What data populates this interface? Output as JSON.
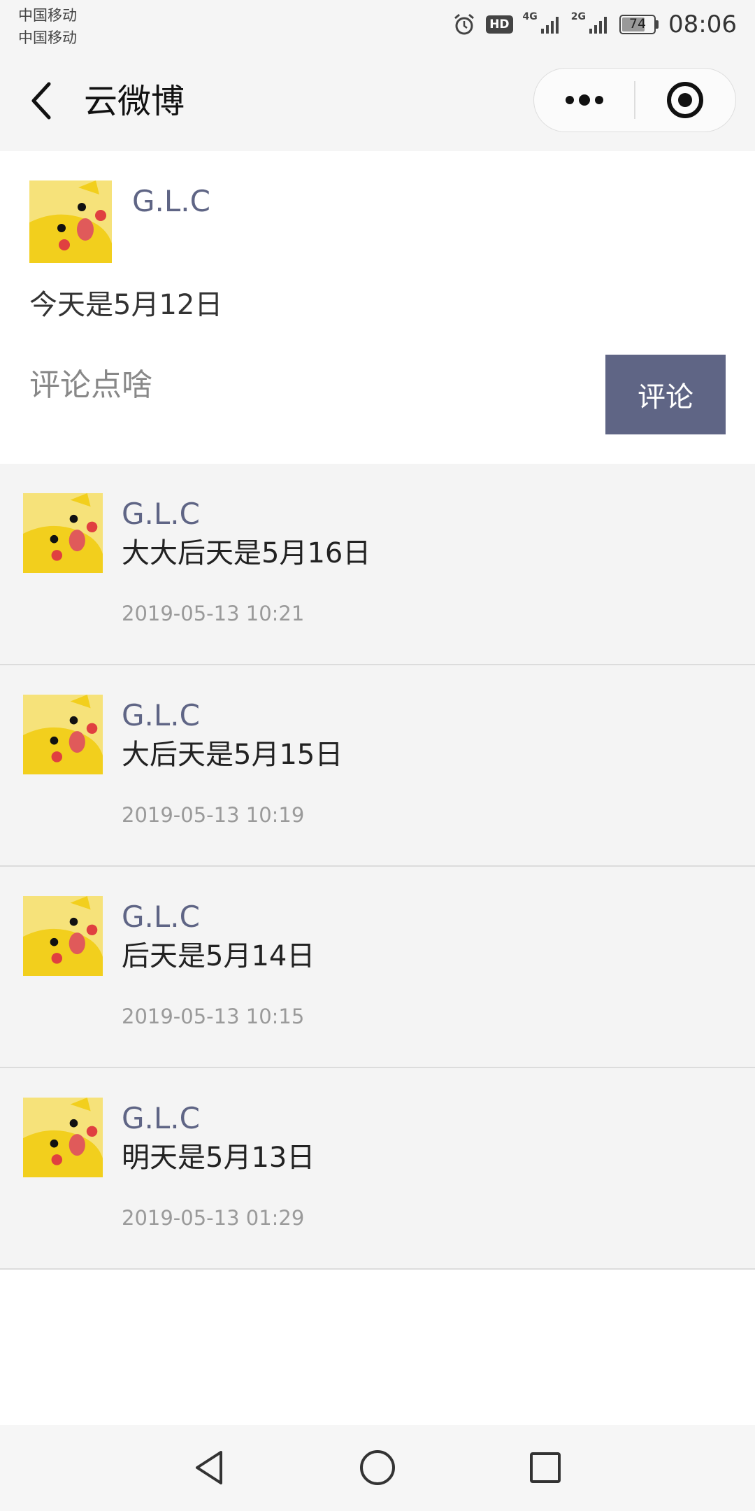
{
  "status_bar": {
    "carrier_1": "中国移动",
    "carrier_2": "中国移动",
    "hd_badge": "HD",
    "network_1": "4G",
    "network_2": "2G",
    "battery_level": 74,
    "battery_text": "74",
    "time": "08:06",
    "icons": [
      "alarm-icon",
      "signal-icon",
      "battery-icon"
    ]
  },
  "nav": {
    "title": "云微博",
    "icons": [
      "back-arrow-icon",
      "more-dots-icon",
      "close-target-icon"
    ]
  },
  "post": {
    "user": "G.L.C",
    "content": "今天是5月12日",
    "comment_placeholder": "评论点啥",
    "comment_button": "评论"
  },
  "comments": [
    {
      "user": "G.L.C",
      "text": "大大后天是5月16日",
      "time": "2019-05-13 10:21"
    },
    {
      "user": "G.L.C",
      "text": "大后天是5月15日",
      "time": "2019-05-13 10:19"
    },
    {
      "user": "G.L.C",
      "text": "后天是5月14日",
      "time": "2019-05-13 10:15"
    },
    {
      "user": "G.L.C",
      "text": "明天是5月13日",
      "time": "2019-05-13 01:29"
    }
  ],
  "system_nav": {
    "icons": [
      "back-triangle-icon",
      "home-circle-icon",
      "recents-square-icon"
    ]
  },
  "colors": {
    "accent": "#5f6585",
    "page_bg": "#f4f4f4",
    "avatar_bg": "#f2d943"
  }
}
